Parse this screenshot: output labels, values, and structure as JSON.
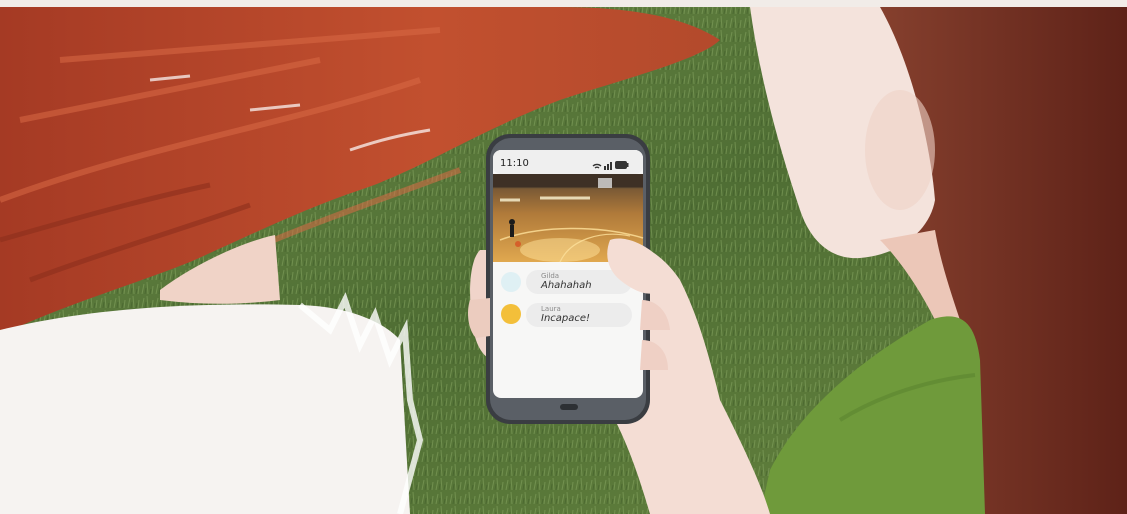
{
  "phone": {
    "status_time": "11:10",
    "status_icons": [
      "wifi-icon",
      "signal-icon",
      "battery-icon"
    ]
  },
  "chat": {
    "messages": [
      {
        "sender": "Gilda",
        "text": "Ahahahah",
        "avatar_color": "#dff0f4"
      },
      {
        "sender": "Laura",
        "text": "Incapace!",
        "avatar_color": "#f3bf3a"
      }
    ]
  },
  "colors": {
    "grass": "#5c7a3e",
    "hair_red": "#b8432a",
    "hair_brown": "#7a3526",
    "shirt_green": "#6f9a3b",
    "skin": "#f1d9cf"
  }
}
